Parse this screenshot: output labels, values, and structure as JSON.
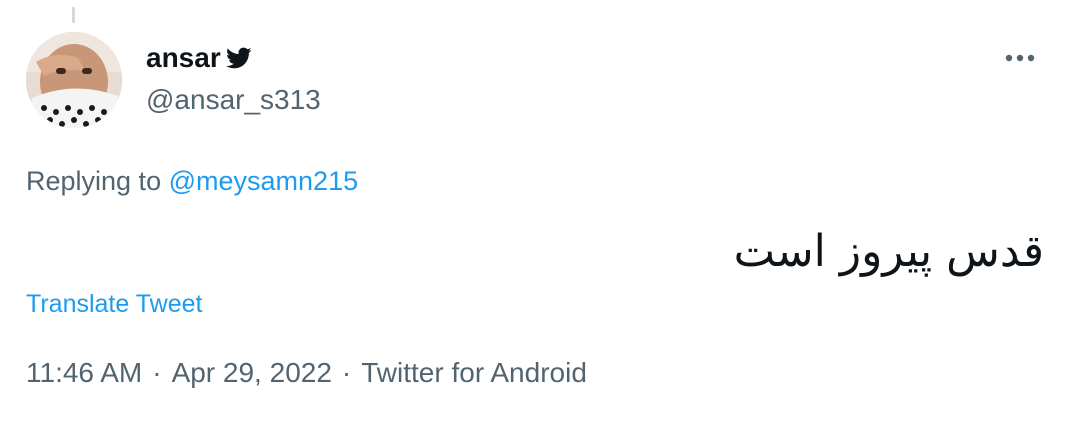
{
  "tweet": {
    "author": {
      "display_name": "ansar",
      "handle": "@ansar_s313",
      "verified_icon": "twitter-bird-icon"
    },
    "replying_prefix": "Replying to",
    "replying_to": "@meysamn215",
    "text": "قدس پیروز است",
    "translate_label": "Translate Tweet",
    "time": "11:46 AM",
    "date": "Apr 29, 2022",
    "source": "Twitter for Android",
    "separator": "·"
  },
  "colors": {
    "link": "#1d9bf0",
    "secondary_text": "#536471",
    "primary_text": "#0f1419"
  }
}
